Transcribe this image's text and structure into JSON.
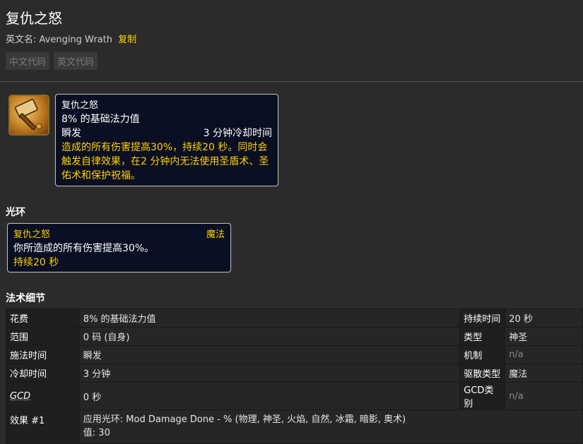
{
  "header": {
    "title": "复仇之怒",
    "en_label": "英文名: Avenging Wrath",
    "copy_label": "复制"
  },
  "code_tabs": [
    "中文代码",
    "英文代码"
  ],
  "spell_icon": {
    "name": "hammer-icon",
    "colors": {
      "bg": "#b8741c",
      "border": "#8a6d1f"
    }
  },
  "tooltip": {
    "name": "复仇之怒",
    "cost": "8% 的基础法力值",
    "cast": "瞬发",
    "cooldown": "3 分钟冷却时间",
    "desc": "造成的所有伤害提高30%，持续20 秒。同时会触发自律效果，在2 分钟内无法使用圣盾术、圣佑术和保护祝福。"
  },
  "aura_section": {
    "heading": "光环",
    "name": "复仇之怒",
    "school": "魔法",
    "effect": "你所造成的所有伤害提高30%。",
    "duration": "持续20 秒"
  },
  "details_section": {
    "heading": "法术细节",
    "rows": [
      {
        "label": "花费",
        "value": "8% 的基础法力值",
        "label2": "持续时间",
        "value2": "20 秒"
      },
      {
        "label": "范围",
        "value": "0 码 (自身)",
        "label2": "类型",
        "value2": "神圣"
      },
      {
        "label": "施法时间",
        "value": "瞬发",
        "label2": "机制",
        "value2": "n/a"
      },
      {
        "label": "冷却时间",
        "value": "3 分钟",
        "label2": "驱散类型",
        "value2": "魔法"
      },
      {
        "label": "GCD",
        "value": "0 秒",
        "label2": "GCD类别",
        "value2": "n/a"
      }
    ],
    "effect": {
      "label": "效果 #1",
      "line1": "应用光环: Mod Damage Done - % (物理, 神圣, 火焰, 自然, 冰霜, 暗影, 奥术)",
      "line2": "值: 30"
    }
  },
  "colors": {
    "accent": "#ffd100",
    "tooltip_bg": "#0a0f23",
    "page_bg": "#2b2b2b"
  }
}
